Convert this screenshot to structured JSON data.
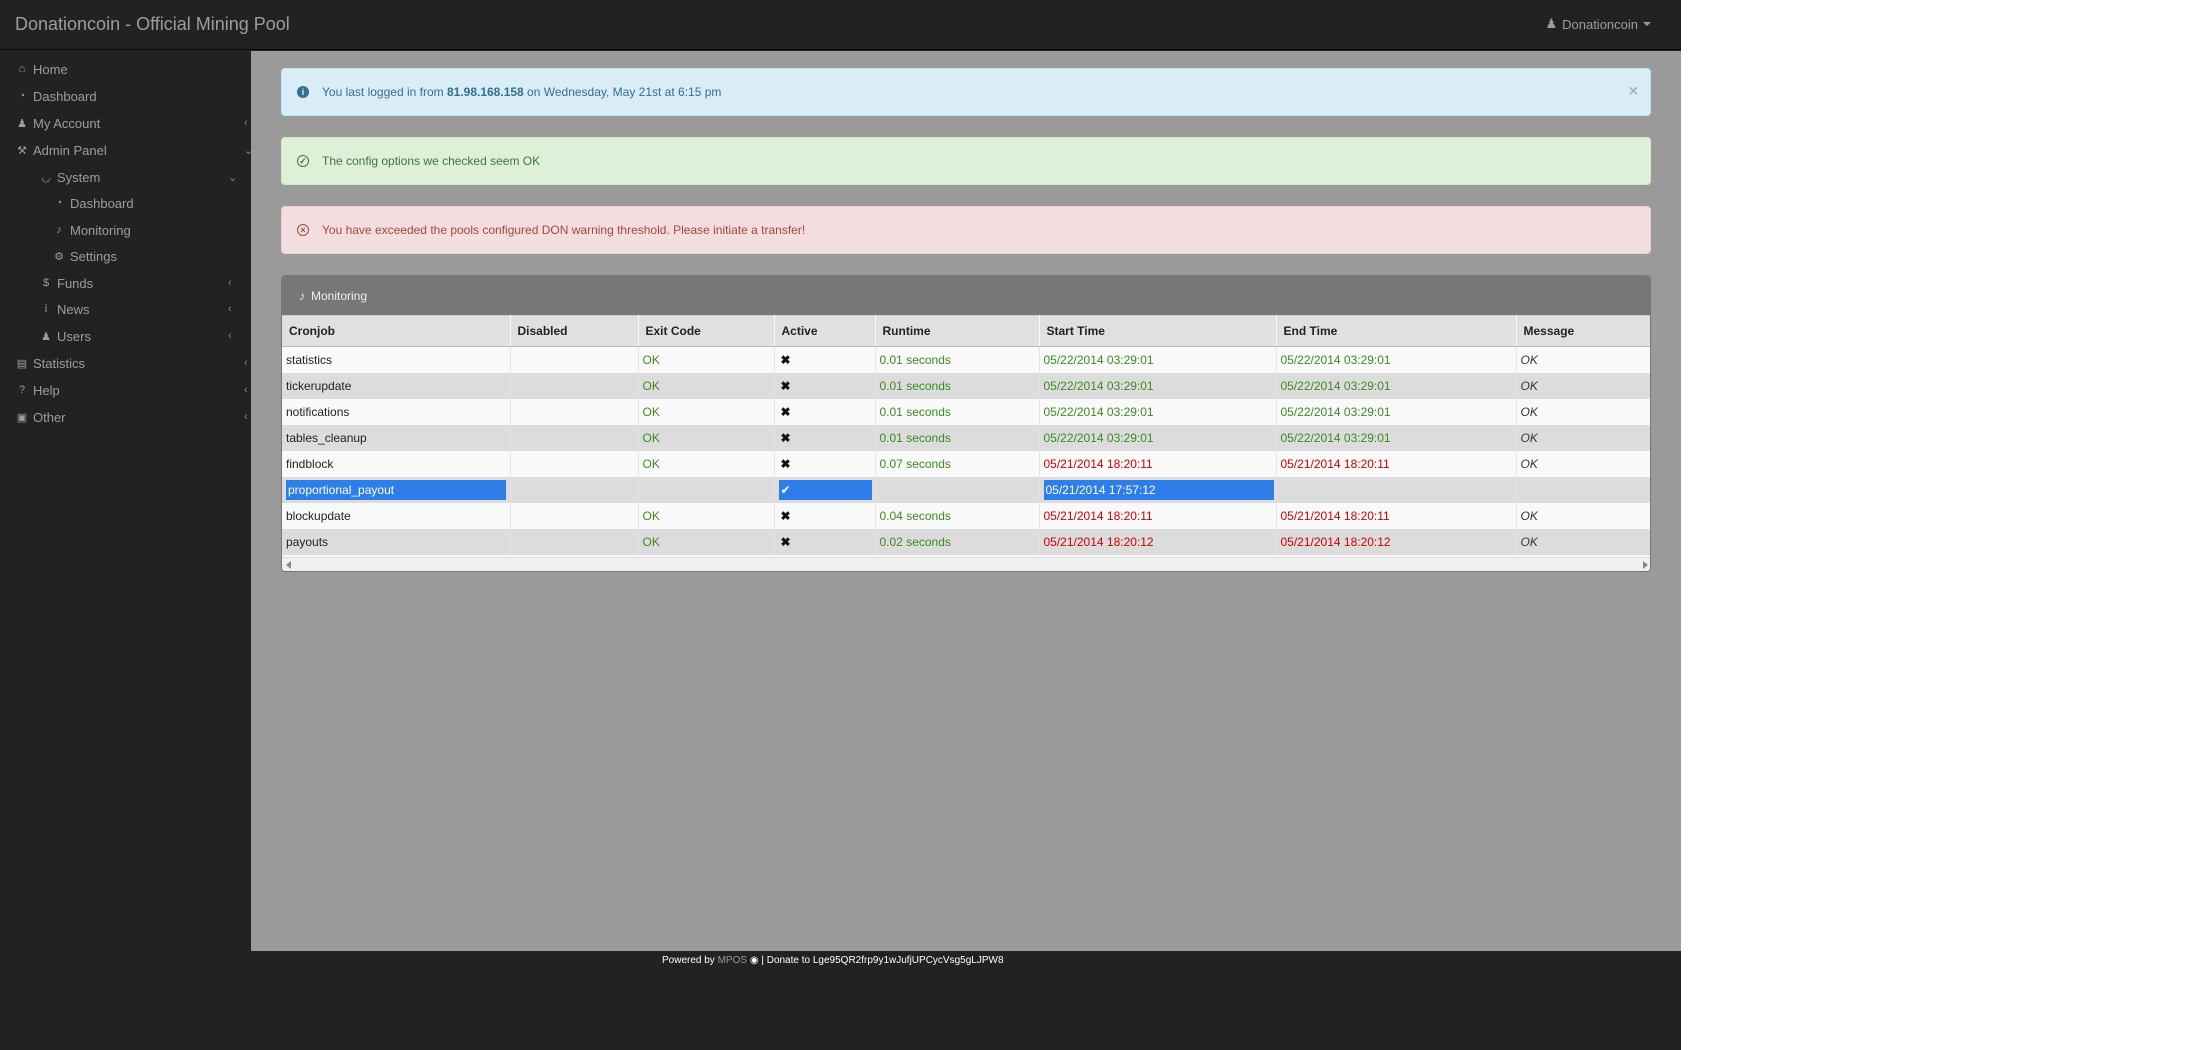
{
  "navbar": {
    "brand": "Donationcoin - Official Mining Pool",
    "user": "Donationcoin"
  },
  "sidebar": {
    "items": [
      {
        "label": "Home",
        "icon": "home-icon"
      },
      {
        "label": "Dashboard",
        "icon": "dashboard-icon"
      },
      {
        "label": "My Account",
        "icon": "user-icon"
      },
      {
        "label": "Admin Panel",
        "icon": "wrench-icon"
      },
      {
        "label": "System",
        "icon": "flask-icon"
      },
      {
        "label": "Dashboard",
        "icon": "dashboard-icon"
      },
      {
        "label": "Monitoring",
        "icon": "bell-icon"
      },
      {
        "label": "Settings",
        "icon": "gears-icon"
      },
      {
        "label": "Funds",
        "icon": "dollar-icon"
      },
      {
        "label": "News",
        "icon": "info-icon"
      },
      {
        "label": "Users",
        "icon": "users-icon"
      },
      {
        "label": "Statistics",
        "icon": "bar-chart-icon"
      },
      {
        "label": "Help",
        "icon": "question-icon"
      },
      {
        "label": "Other",
        "icon": "credit-card-icon"
      }
    ]
  },
  "alerts": {
    "info_prefix": "You last logged in from ",
    "info_ip": "81.98.168.158",
    "info_suffix": " on Wednesday, May 21st at 6:15 pm",
    "success": "The config options we checked seem OK",
    "danger": "You have exceeded the pools configured DON warning threshold. Please initiate a transfer!"
  },
  "panel": {
    "title": "Monitoring",
    "columns": [
      "Cronjob",
      "Disabled",
      "Exit Code",
      "Active",
      "Runtime",
      "Start Time",
      "End Time",
      "Message"
    ],
    "rows": [
      {
        "cronjob": "statistics",
        "disabled": "",
        "exit_code": "OK",
        "active": "✖",
        "runtime": "0.01 seconds",
        "start": "05/22/2014 03:29:01",
        "end": "05/22/2014 03:29:01",
        "message": "OK"
      },
      {
        "cronjob": "tickerupdate",
        "disabled": "",
        "exit_code": "OK",
        "active": "✖",
        "runtime": "0.01 seconds",
        "start": "05/22/2014 03:29:01",
        "end": "05/22/2014 03:29:01",
        "message": "OK"
      },
      {
        "cronjob": "notifications",
        "disabled": "",
        "exit_code": "OK",
        "active": "✖",
        "runtime": "0.01 seconds",
        "start": "05/22/2014 03:29:01",
        "end": "05/22/2014 03:29:01",
        "message": "OK"
      },
      {
        "cronjob": "tables_cleanup",
        "disabled": "",
        "exit_code": "OK",
        "active": "✖",
        "runtime": "0.01 seconds",
        "start": "05/22/2014 03:29:01",
        "end": "05/22/2014 03:29:01",
        "message": "OK"
      },
      {
        "cronjob": "findblock",
        "disabled": "",
        "exit_code": "OK",
        "active": "✖",
        "runtime": "0.07 seconds",
        "start": "05/21/2014 18:20:11",
        "end": "05/21/2014 18:20:11",
        "message": "OK"
      },
      {
        "cronjob": "proportional_payout",
        "disabled": "",
        "exit_code": "",
        "active": "✔",
        "runtime": "",
        "start": "05/21/2014 17:57:12",
        "end": "",
        "message": ""
      },
      {
        "cronjob": "blockupdate",
        "disabled": "",
        "exit_code": "OK",
        "active": "✖",
        "runtime": "0.04 seconds",
        "start": "05/21/2014 18:20:11",
        "end": "05/21/2014 18:20:11",
        "message": "OK"
      },
      {
        "cronjob": "payouts",
        "disabled": "",
        "exit_code": "OK",
        "active": "✖",
        "runtime": "0.02 seconds",
        "start": "05/21/2014 18:20:12",
        "end": "05/21/2014 18:20:12",
        "message": "OK"
      }
    ]
  },
  "footer": {
    "powered_by": "Powered by ",
    "mpos": "MPOS",
    "donate": " | Donate to Lge95QR2frp9y1wJufjUPCycVsg5gLJPW8"
  }
}
